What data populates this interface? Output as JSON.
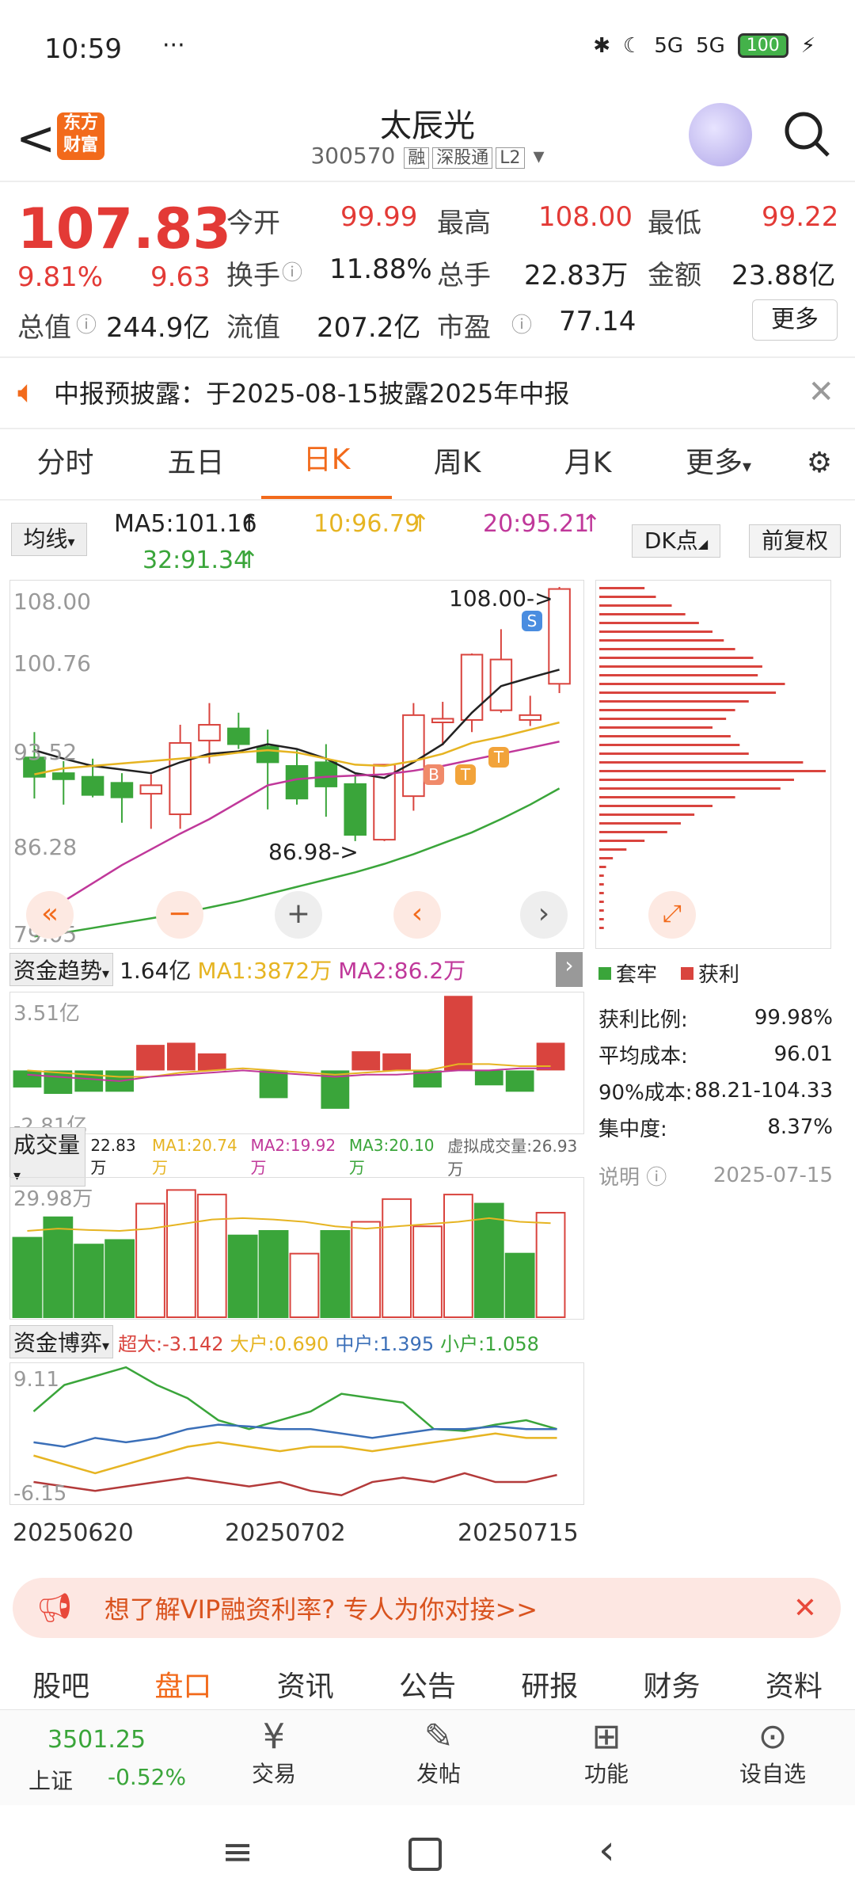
{
  "status": {
    "time": "10:59",
    "dots": "···",
    "signal1": "5G",
    "signal2": "5G",
    "battery": "100"
  },
  "header": {
    "title": "太辰光",
    "code": "300570",
    "tag1": "融",
    "tag2": "深股通",
    "tag3": "L2"
  },
  "quote": {
    "price": "107.83",
    "pct": "9.81%",
    "change": "9.63",
    "open_label": "今开",
    "open": "99.99",
    "high_label": "最高",
    "high": "108.00",
    "low_label": "最低",
    "low": "99.22",
    "turnover_label": "换手",
    "turnover": "11.88%",
    "vol_label": "总手",
    "vol": "22.83万",
    "amount_label": "金额",
    "amount": "23.88亿",
    "mktcap_label": "总值",
    "mktcap": "244.9亿",
    "float_label": "流值",
    "float": "207.2亿",
    "pe_label": "市盈",
    "pe": "77.14",
    "more": "更多"
  },
  "notice": {
    "text": "中报预披露：于2025-08-15披露2025年中报"
  },
  "tabs": [
    "分时",
    "五日",
    "日K",
    "周K",
    "月K",
    "更多"
  ],
  "ma": {
    "select": "均线",
    "ma5": "MA5:101.16",
    "ma10": "10:96.79",
    "ma20": "20:95.21",
    "ma32": "32:91.34",
    "dk": "DK点",
    "fq": "前复权"
  },
  "kchart": {
    "y_labels": [
      "108.00",
      "100.76",
      "93.52",
      "86.28",
      "79.05"
    ],
    "hi_note": "108.00->",
    "lo_note": "86.98->",
    "marks": [
      "S",
      "B",
      "T",
      "T"
    ],
    "candles": [
      {
        "o": 93.9,
        "h": 96.0,
        "l": 90.5,
        "c": 92.3
      },
      {
        "o": 92.6,
        "h": 93.6,
        "l": 90.0,
        "c": 92.1
      },
      {
        "o": 92.3,
        "h": 93.8,
        "l": 90.6,
        "c": 90.8
      },
      {
        "o": 91.8,
        "h": 92.6,
        "l": 88.5,
        "c": 90.6
      },
      {
        "o": 90.9,
        "h": 92.5,
        "l": 88.0,
        "c": 91.6
      },
      {
        "o": 89.2,
        "h": 96.6,
        "l": 88.0,
        "c": 95.1
      },
      {
        "o": 95.3,
        "h": 98.4,
        "l": 93.4,
        "c": 96.6
      },
      {
        "o": 96.3,
        "h": 97.6,
        "l": 94.6,
        "c": 95.0
      },
      {
        "o": 94.8,
        "h": 96.2,
        "l": 89.6,
        "c": 93.5
      },
      {
        "o": 93.2,
        "h": 94.5,
        "l": 90.0,
        "c": 90.5
      },
      {
        "o": 93.5,
        "h": 95.0,
        "l": 89.0,
        "c": 91.5
      },
      {
        "o": 91.7,
        "h": 92.5,
        "l": 86.98,
        "c": 87.5
      },
      {
        "o": 87.1,
        "h": 93.2,
        "l": 86.98,
        "c": 93.3
      },
      {
        "o": 90.7,
        "h": 98.4,
        "l": 89.5,
        "c": 97.4
      },
      {
        "o": 96.8,
        "h": 98.5,
        "l": 94.9,
        "c": 97.1
      },
      {
        "o": 97.0,
        "h": 102.5,
        "l": 96.0,
        "c": 102.4
      },
      {
        "o": 97.8,
        "h": 104.5,
        "l": 97.6,
        "c": 102.0
      },
      {
        "o": 97.0,
        "h": 99.0,
        "l": 96.5,
        "c": 97.4
      },
      {
        "o": 99.99,
        "h": 108.0,
        "l": 99.22,
        "c": 107.83
      }
    ]
  },
  "chip": {
    "legend1": "套牢",
    "legend2": "获利",
    "rows": [
      {
        "k": "获利比例:",
        "v": "99.98%"
      },
      {
        "k": "平均成本:",
        "v": "96.01"
      },
      {
        "k": "90%成本:",
        "v": "88.21-104.33"
      },
      {
        "k": "集中度:",
        "v": "8.37%"
      }
    ],
    "note": "说明",
    "date": "2025-07-15"
  },
  "flow": {
    "select": "资金趋势",
    "val": "1.64亿",
    "ma1": "MA1:3872万",
    "ma2": "MA2:86.2万",
    "ytop": "3.51亿",
    "ybot": "-2.81亿",
    "values": [
      -0.8,
      -1.1,
      -1.0,
      -1.0,
      1.2,
      1.3,
      0.8,
      0,
      -1.3,
      0,
      -1.8,
      0.9,
      0.8,
      -0.8,
      3.5,
      -0.7,
      -1.0,
      1.3
    ]
  },
  "volume": {
    "select": "成交量",
    "v": "22.83万",
    "ma1": "MA1:20.74万",
    "ma2": "MA2:19.92万",
    "ma3": "MA3:20.10万",
    "virtual": "虚拟成交量:26.93万",
    "ytop": "29.98万",
    "bars": [
      {
        "v": 17.5,
        "up": false
      },
      {
        "v": 22.0,
        "up": false
      },
      {
        "v": 16.0,
        "up": false
      },
      {
        "v": 17.0,
        "up": false
      },
      {
        "v": 25.0,
        "up": true
      },
      {
        "v": 28.0,
        "up": true
      },
      {
        "v": 27.0,
        "up": true
      },
      {
        "v": 18.0,
        "up": false
      },
      {
        "v": 19.0,
        "up": false
      },
      {
        "v": 14.0,
        "up": true
      },
      {
        "v": 19.0,
        "up": false
      },
      {
        "v": 21.0,
        "up": true
      },
      {
        "v": 26.0,
        "up": true
      },
      {
        "v": 20.0,
        "up": true
      },
      {
        "v": 27.0,
        "up": true
      },
      {
        "v": 25.0,
        "up": false
      },
      {
        "v": 14.0,
        "up": false
      },
      {
        "v": 23.0,
        "up": true
      }
    ]
  },
  "game": {
    "select": "资金博弈",
    "s1": "超大:-3.142",
    "s2": "大户:0.690",
    "s3": "中户:1.395",
    "s4": "小户:1.058",
    "ytop": "9.11",
    "ybot": "-6.15"
  },
  "dates": [
    "20250620",
    "20250702",
    "20250715"
  ],
  "vip": {
    "text": "想了解VIP融资利率? 专人为你对接>>"
  },
  "bottom_tabs": [
    "股吧",
    "盘口",
    "资讯",
    "公告",
    "研报",
    "财务",
    "资料"
  ],
  "dock": {
    "index_value": "3501.25",
    "index_name": "上证",
    "index_pct": "-0.52%",
    "trade": "交易",
    "post": "发帖",
    "func": "功能",
    "watch": "设自选"
  }
}
